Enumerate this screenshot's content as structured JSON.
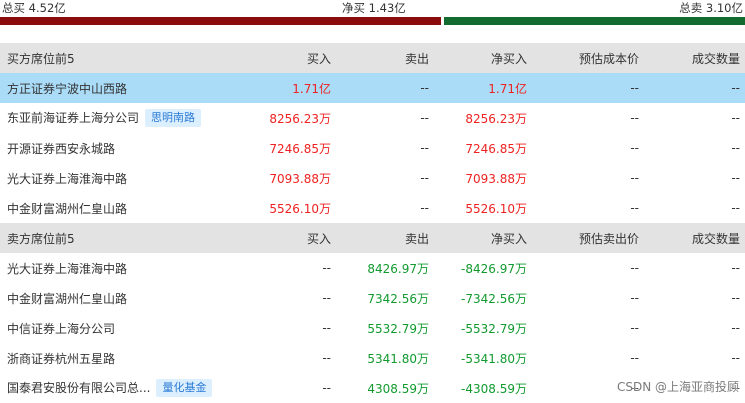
{
  "summary": {
    "total_buy": "总买 4.52亿",
    "net_buy": "净买 1.43亿",
    "total_sell": "总卖 3.10亿"
  },
  "colors": {
    "buy_bar": "#8b0c0c",
    "sell_bar": "#136b2f",
    "up": "#ee2222",
    "down": "#129a2f",
    "highlight": "#aadcf8",
    "tag_bg": "#dcefff",
    "tag_text": "#2b7bd6"
  },
  "buy_table": {
    "headers": [
      "买方席位前5",
      "买入",
      "卖出",
      "净买入",
      "预估成本价",
      "成交数量"
    ],
    "rows": [
      {
        "name": "方正证券宁波中山西路",
        "tag": "",
        "buy": "1.71亿",
        "sell": "--",
        "net": "1.71亿",
        "price": "--",
        "volume": "--"
      },
      {
        "name": "东亚前海证券上海分公司",
        "tag": "思明南路",
        "buy": "8256.23万",
        "sell": "--",
        "net": "8256.23万",
        "price": "--",
        "volume": "--"
      },
      {
        "name": "开源证券西安永城路",
        "tag": "",
        "buy": "7246.85万",
        "sell": "--",
        "net": "7246.85万",
        "price": "--",
        "volume": "--"
      },
      {
        "name": "光大证券上海淮海中路",
        "tag": "",
        "buy": "7093.88万",
        "sell": "--",
        "net": "7093.88万",
        "price": "--",
        "volume": "--"
      },
      {
        "name": "中金财富湖州仁皇山路",
        "tag": "",
        "buy": "5526.10万",
        "sell": "--",
        "net": "5526.10万",
        "price": "--",
        "volume": "--"
      }
    ]
  },
  "sell_table": {
    "headers": [
      "卖方席位前5",
      "买入",
      "卖出",
      "净买入",
      "预估卖出价",
      "成交数量"
    ],
    "rows": [
      {
        "name": "光大证券上海淮海中路",
        "tag": "",
        "buy": "--",
        "sell": "8426.97万",
        "net": "-8426.97万",
        "price": "--",
        "volume": "--"
      },
      {
        "name": "中金财富湖州仁皇山路",
        "tag": "",
        "buy": "--",
        "sell": "7342.56万",
        "net": "-7342.56万",
        "price": "--",
        "volume": "--"
      },
      {
        "name": "中信证券上海分公司",
        "tag": "",
        "buy": "--",
        "sell": "5532.79万",
        "net": "-5532.79万",
        "price": "--",
        "volume": "--"
      },
      {
        "name": "浙商证券杭州五星路",
        "tag": "",
        "buy": "--",
        "sell": "5341.80万",
        "net": "-5341.80万",
        "price": "--",
        "volume": "--"
      },
      {
        "name": "国泰君安股份有限公司总...",
        "tag": "量化基金",
        "buy": "--",
        "sell": "4308.59万",
        "net": "-4308.59万",
        "price": "--",
        "volume": "--"
      }
    ]
  },
  "watermark": "CSDN @上海亚商投顾"
}
